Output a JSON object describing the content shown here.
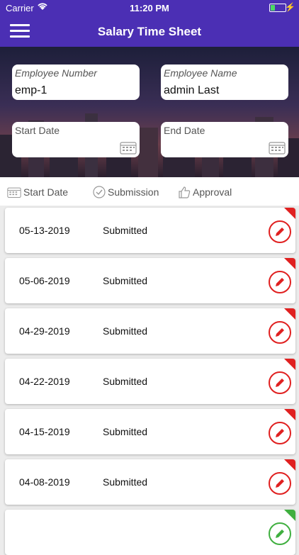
{
  "status_bar": {
    "carrier": "Carrier",
    "time": "11:20 PM",
    "battery_level": 0.3
  },
  "nav": {
    "title": "Salary Time Sheet",
    "menu_icon": "hamburger-menu-icon"
  },
  "form": {
    "employee_number": {
      "label": "Employee Number",
      "value": "emp-1"
    },
    "employee_name": {
      "label": "Employee Name",
      "value": "admin Last"
    },
    "start_date": {
      "label": "Start Date",
      "value": ""
    },
    "end_date": {
      "label": "End Date",
      "value": ""
    }
  },
  "list_header": {
    "start_date": "Start Date",
    "submission": "Submission",
    "approval": "Approval"
  },
  "rows": [
    {
      "date": "05-13-2019",
      "status": "Submitted",
      "flag": "red"
    },
    {
      "date": "05-06-2019",
      "status": "Submitted",
      "flag": "red"
    },
    {
      "date": "04-29-2019",
      "status": "Submitted",
      "flag": "red"
    },
    {
      "date": "04-22-2019",
      "status": "Submitted",
      "flag": "red"
    },
    {
      "date": "04-15-2019",
      "status": "Submitted",
      "flag": "red"
    },
    {
      "date": "04-08-2019",
      "status": "Submitted",
      "flag": "red"
    },
    {
      "date": "",
      "status": "",
      "flag": "green"
    }
  ],
  "colors": {
    "nav": "#4b2fb4",
    "flag_red": "#e02020",
    "flag_green": "#3faf3f"
  }
}
